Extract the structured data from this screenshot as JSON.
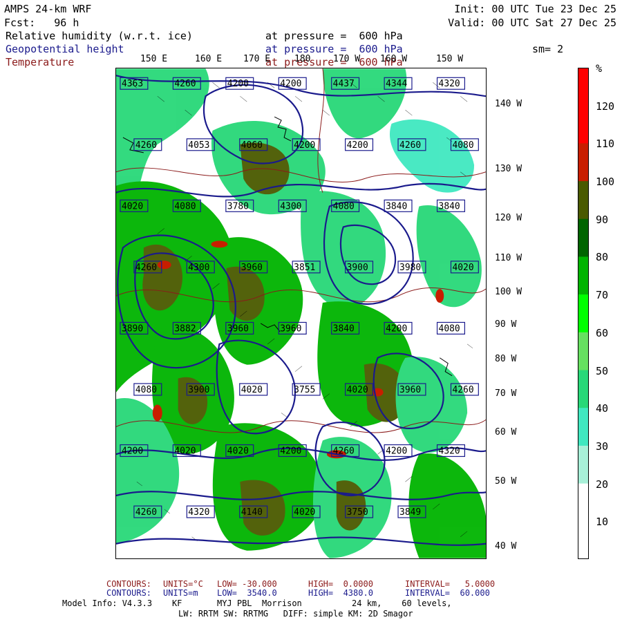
{
  "header": {
    "model": "AMPS 24-km WRF",
    "fcst": "Fcst:   96 h",
    "init": "Init: 00 UTC Tue 23 Dec 25",
    "valid": "Valid: 00 UTC Sat 27 Dec 25",
    "fields": [
      {
        "name": "Relative humidity (w.r.t. ice)",
        "level": "at pressure =  600 hPa",
        "color": "#000000"
      },
      {
        "name": "Geopotential height",
        "level": "at pressure =  600 hPa",
        "color": "#1a1a8c"
      },
      {
        "name": "Temperature",
        "level": "at pressure =  600 hPa",
        "color": "#8b1a1a"
      }
    ],
    "smoothing": "sm= 2"
  },
  "lon_labels": [
    "150 E",
    "160 E",
    "170 E",
    "180",
    "170 W",
    "160 W",
    "150 W"
  ],
  "lat_labels": [
    "140 W",
    "130 W",
    "120 W",
    "110 W",
    "100 W",
    "90 W",
    "80 W",
    "70 W",
    "60 W",
    "50 W",
    "40 W"
  ],
  "height_labels": [
    "4363",
    "4260",
    "4200",
    "4200",
    "4437",
    "4344",
    "4320",
    "4260",
    "4053",
    "4060",
    "4200",
    "4200",
    "4260",
    "4080",
    "4020",
    "4080",
    "3780",
    "4300",
    "4080",
    "3840",
    "3840",
    "4260",
    "4300",
    "3960",
    "3851",
    "3900",
    "3980",
    "4020",
    "3890",
    "3882",
    "3960",
    "3960",
    "3840",
    "4200",
    "4080",
    "4080",
    "3900",
    "4020",
    "3755",
    "4020",
    "3960",
    "4260",
    "4200",
    "4020",
    "4020",
    "4200",
    "4260",
    "4200",
    "4320",
    "4260",
    "4320",
    "4140",
    "4020",
    "3750",
    "3849"
  ],
  "colorbar": {
    "unit": "%",
    "labels": [
      "120",
      "110",
      "100",
      "90",
      "80",
      "70",
      "60",
      "50",
      "40",
      "30",
      "20",
      "10"
    ],
    "colors": [
      "#ff0000",
      "#c81e00",
      "#4a5a00",
      "#006400",
      "#00b400",
      "#00ff00",
      "#66e060",
      "#28d878",
      "#40e8c0",
      "#a8f0d8",
      "#ffffff",
      "#ffffff"
    ]
  },
  "footer": {
    "line1": {
      "label": "CONTOURS:",
      "units": "UNITS=°C",
      "low": "LOW= -30.000",
      "high": "HIGH=  0.0000",
      "interval": "INTERVAL=   5.0000",
      "color": "#8b1a1a"
    },
    "line2": {
      "label": "CONTOURS:",
      "units": "UNITS=m",
      "low": "LOW=  3540.0",
      "high": "HIGH=  4380.0",
      "interval": "INTERVAL=  60.000",
      "color": "#1a1a8c"
    },
    "line3": "Model Info: V4.3.3    KF       MYJ PBL  Morrison          24 km,    60 levels,",
    "line4": "LW: RRTM SW: RRTMG   DIFF: simple KM: 2D Smagor"
  }
}
